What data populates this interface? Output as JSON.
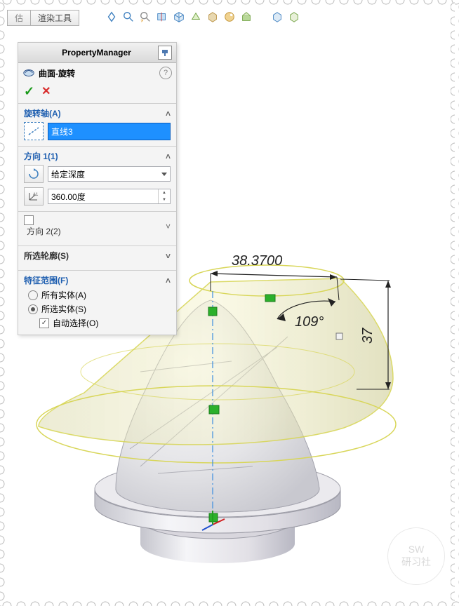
{
  "tabs": {
    "t0": "估",
    "t1": "渲染工具"
  },
  "panel": {
    "header": "PropertyManager",
    "feature_name": "曲面-旋转",
    "axis": {
      "title": "旋转轴(A)",
      "value": "直线3"
    },
    "dir1": {
      "title": "方向 1(1)",
      "type": "给定深度",
      "angle": "360.00度"
    },
    "dir2": {
      "title": "方向 2(2)",
      "enabled": false
    },
    "contours": {
      "title": "所选轮廓(S)"
    },
    "scope": {
      "title": "特征范围(F)",
      "opt_all": "所有实体(A)",
      "opt_sel": "所选实体(S)",
      "opt_auto": "自动选择(O)"
    }
  },
  "dims": {
    "top": "38.3700",
    "angle": "109°",
    "height": "37"
  },
  "watermark": {
    "l1": "SW",
    "l2": "研习社"
  }
}
